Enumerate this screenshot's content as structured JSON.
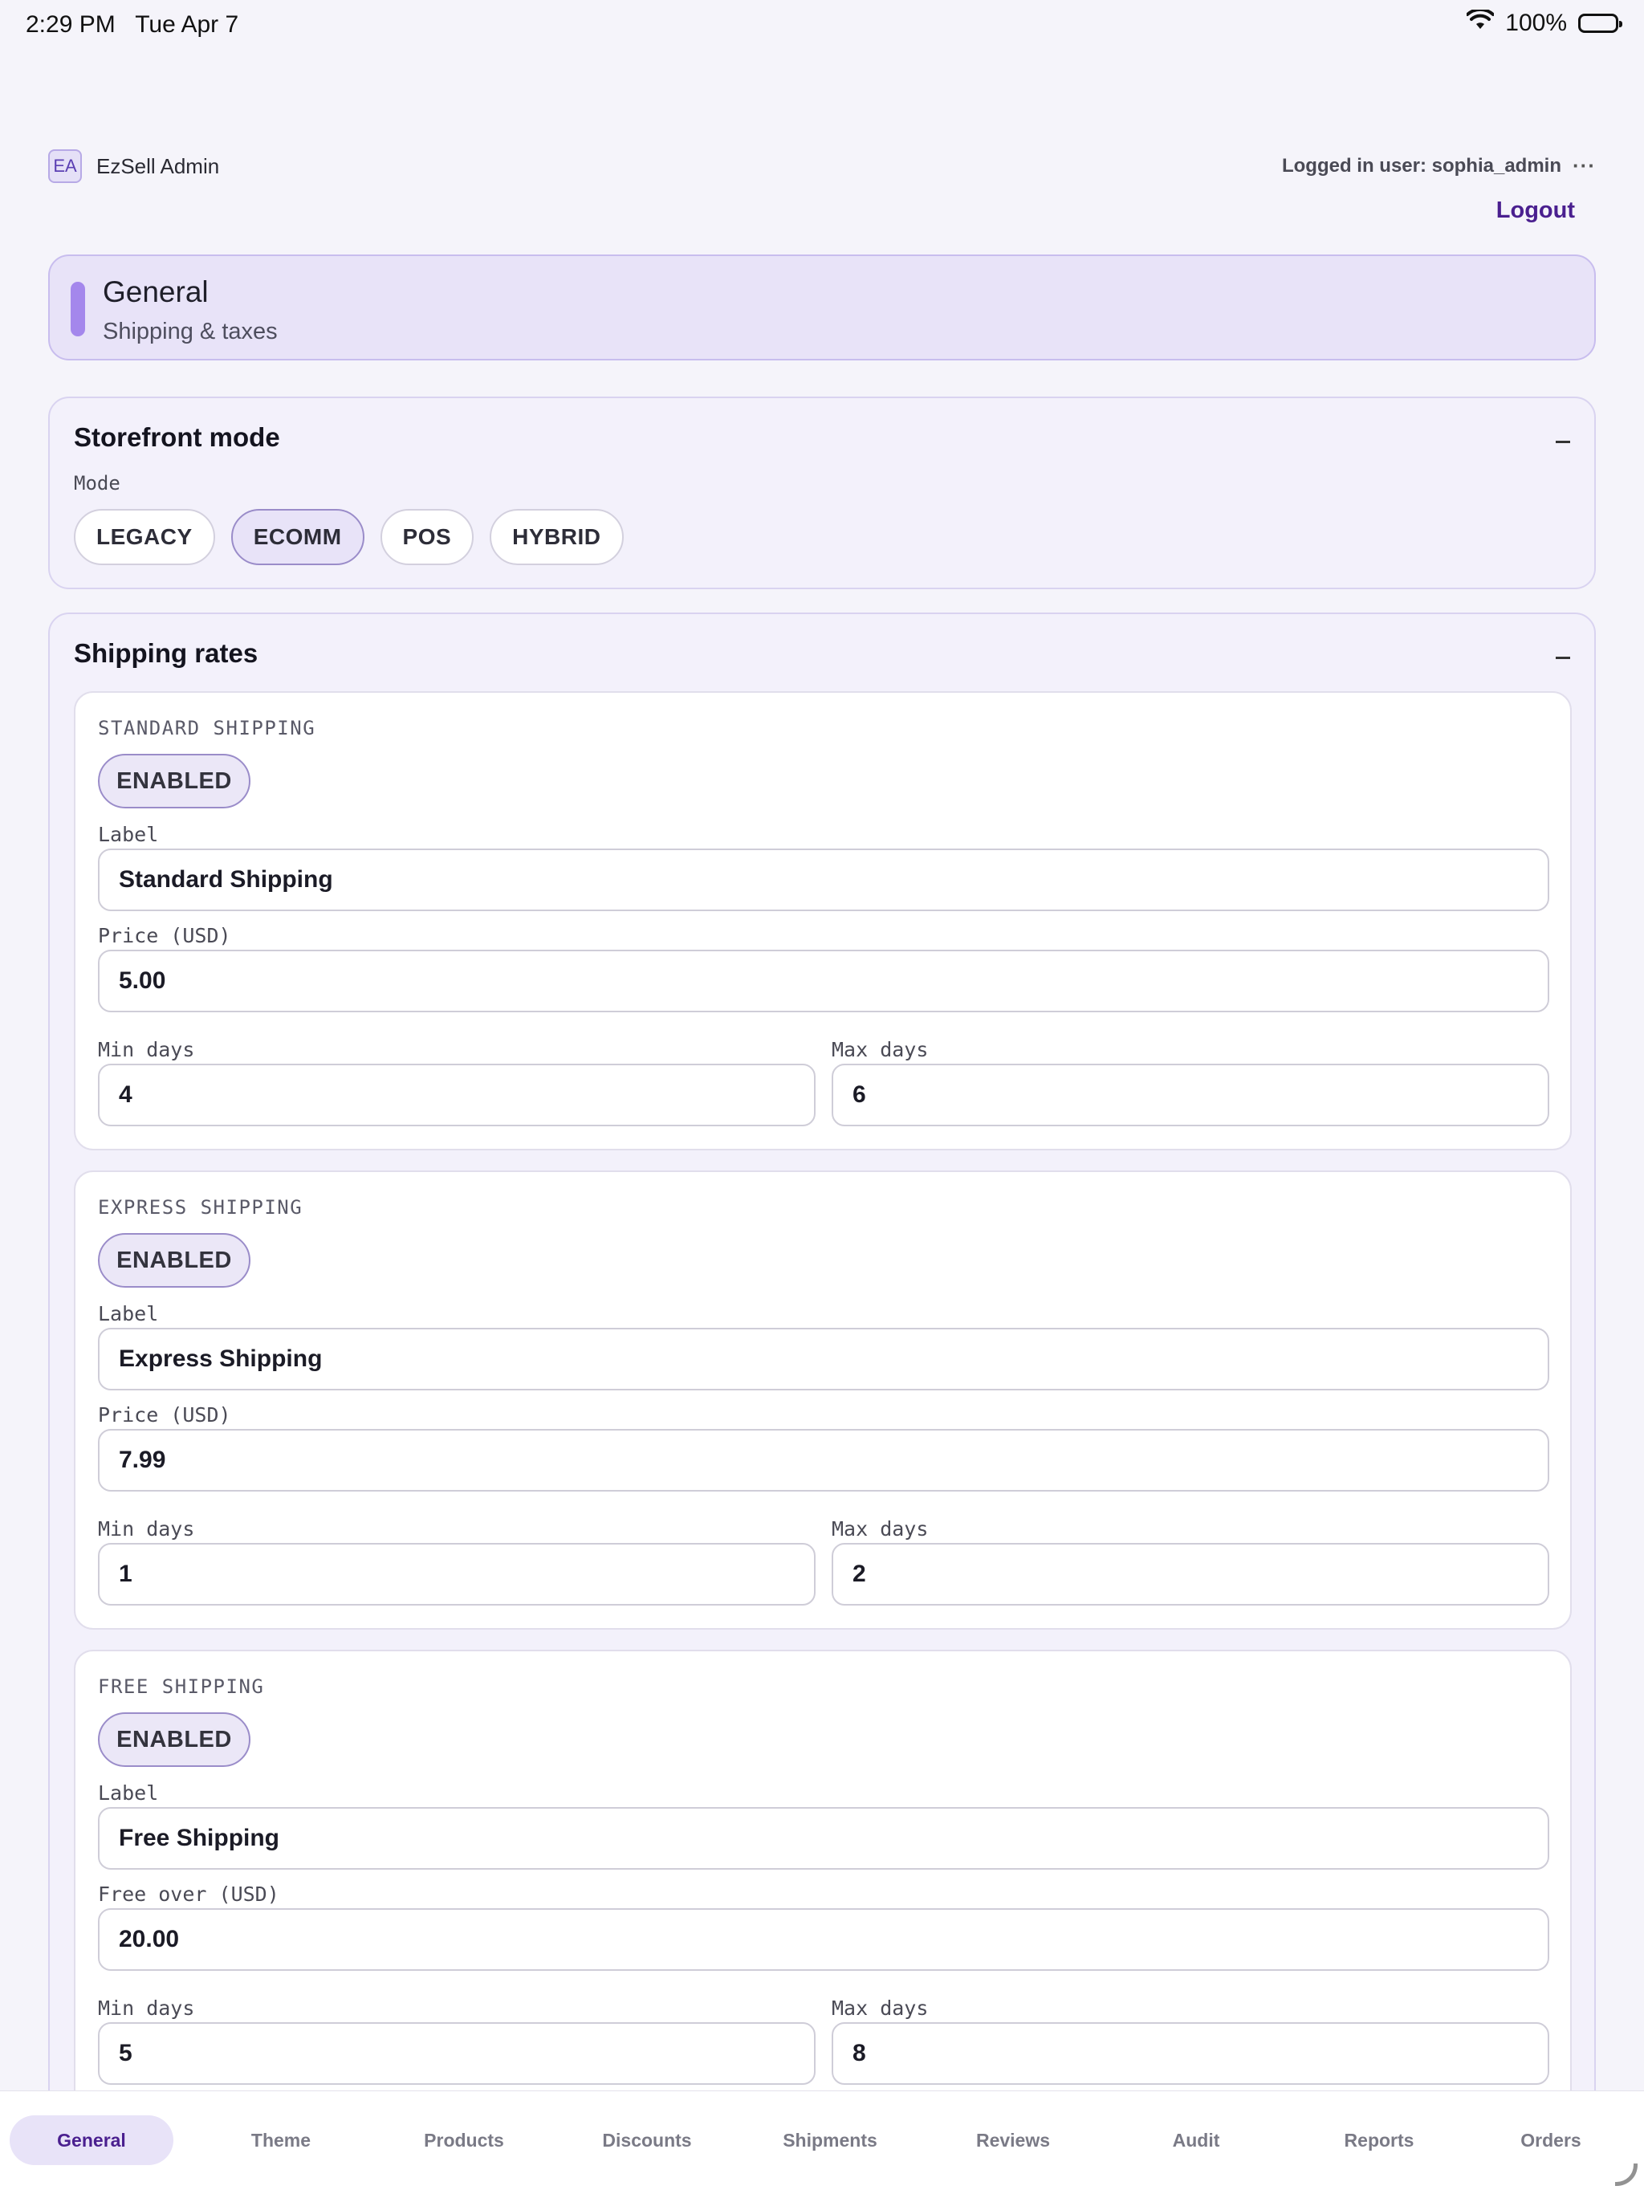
{
  "status_bar": {
    "time": "2:29 PM",
    "date": "Tue Apr 7",
    "battery": "100%"
  },
  "header": {
    "brand_initials": "EA",
    "brand_name": "EzSell Admin",
    "logged_in": "Logged in user: sophia_admin",
    "more": "···",
    "logout": "Logout"
  },
  "banner": {
    "title": "General",
    "subtitle": "Shipping & taxes"
  },
  "storefront": {
    "title": "Storefront mode",
    "mode_label": "Mode",
    "options": [
      "LEGACY",
      "ECOMM",
      "POS",
      "HYBRID"
    ],
    "selected": "ECOMM"
  },
  "shipping": {
    "title": "Shipping rates",
    "rates": [
      {
        "heading": "STANDARD SHIPPING",
        "toggle": "ENABLED",
        "label_label": "Label",
        "label_value": "Standard Shipping",
        "price_label": "Price (USD)",
        "price_value": "5.00",
        "min_label": "Min days",
        "min_value": "4",
        "max_label": "Max days",
        "max_value": "6"
      },
      {
        "heading": "EXPRESS SHIPPING",
        "toggle": "ENABLED",
        "label_label": "Label",
        "label_value": "Express Shipping",
        "price_label": "Price (USD)",
        "price_value": "7.99",
        "min_label": "Min days",
        "min_value": "1",
        "max_label": "Max days",
        "max_value": "2"
      },
      {
        "heading": "FREE SHIPPING",
        "toggle": "ENABLED",
        "label_label": "Label",
        "label_value": "Free Shipping",
        "price_label": "Free over (USD)",
        "price_value": "20.00",
        "min_label": "Min days",
        "min_value": "5",
        "max_label": "Max days",
        "max_value": "8"
      }
    ]
  },
  "tabs": {
    "items": [
      "General",
      "Theme",
      "Products",
      "Discounts",
      "Shipments",
      "Reviews",
      "Audit",
      "Reports",
      "Orders"
    ],
    "active": "General"
  },
  "colors": {
    "accent": "#4a1f8f",
    "accent_soft": "#e8e3f8",
    "bar": "#a487ec"
  }
}
